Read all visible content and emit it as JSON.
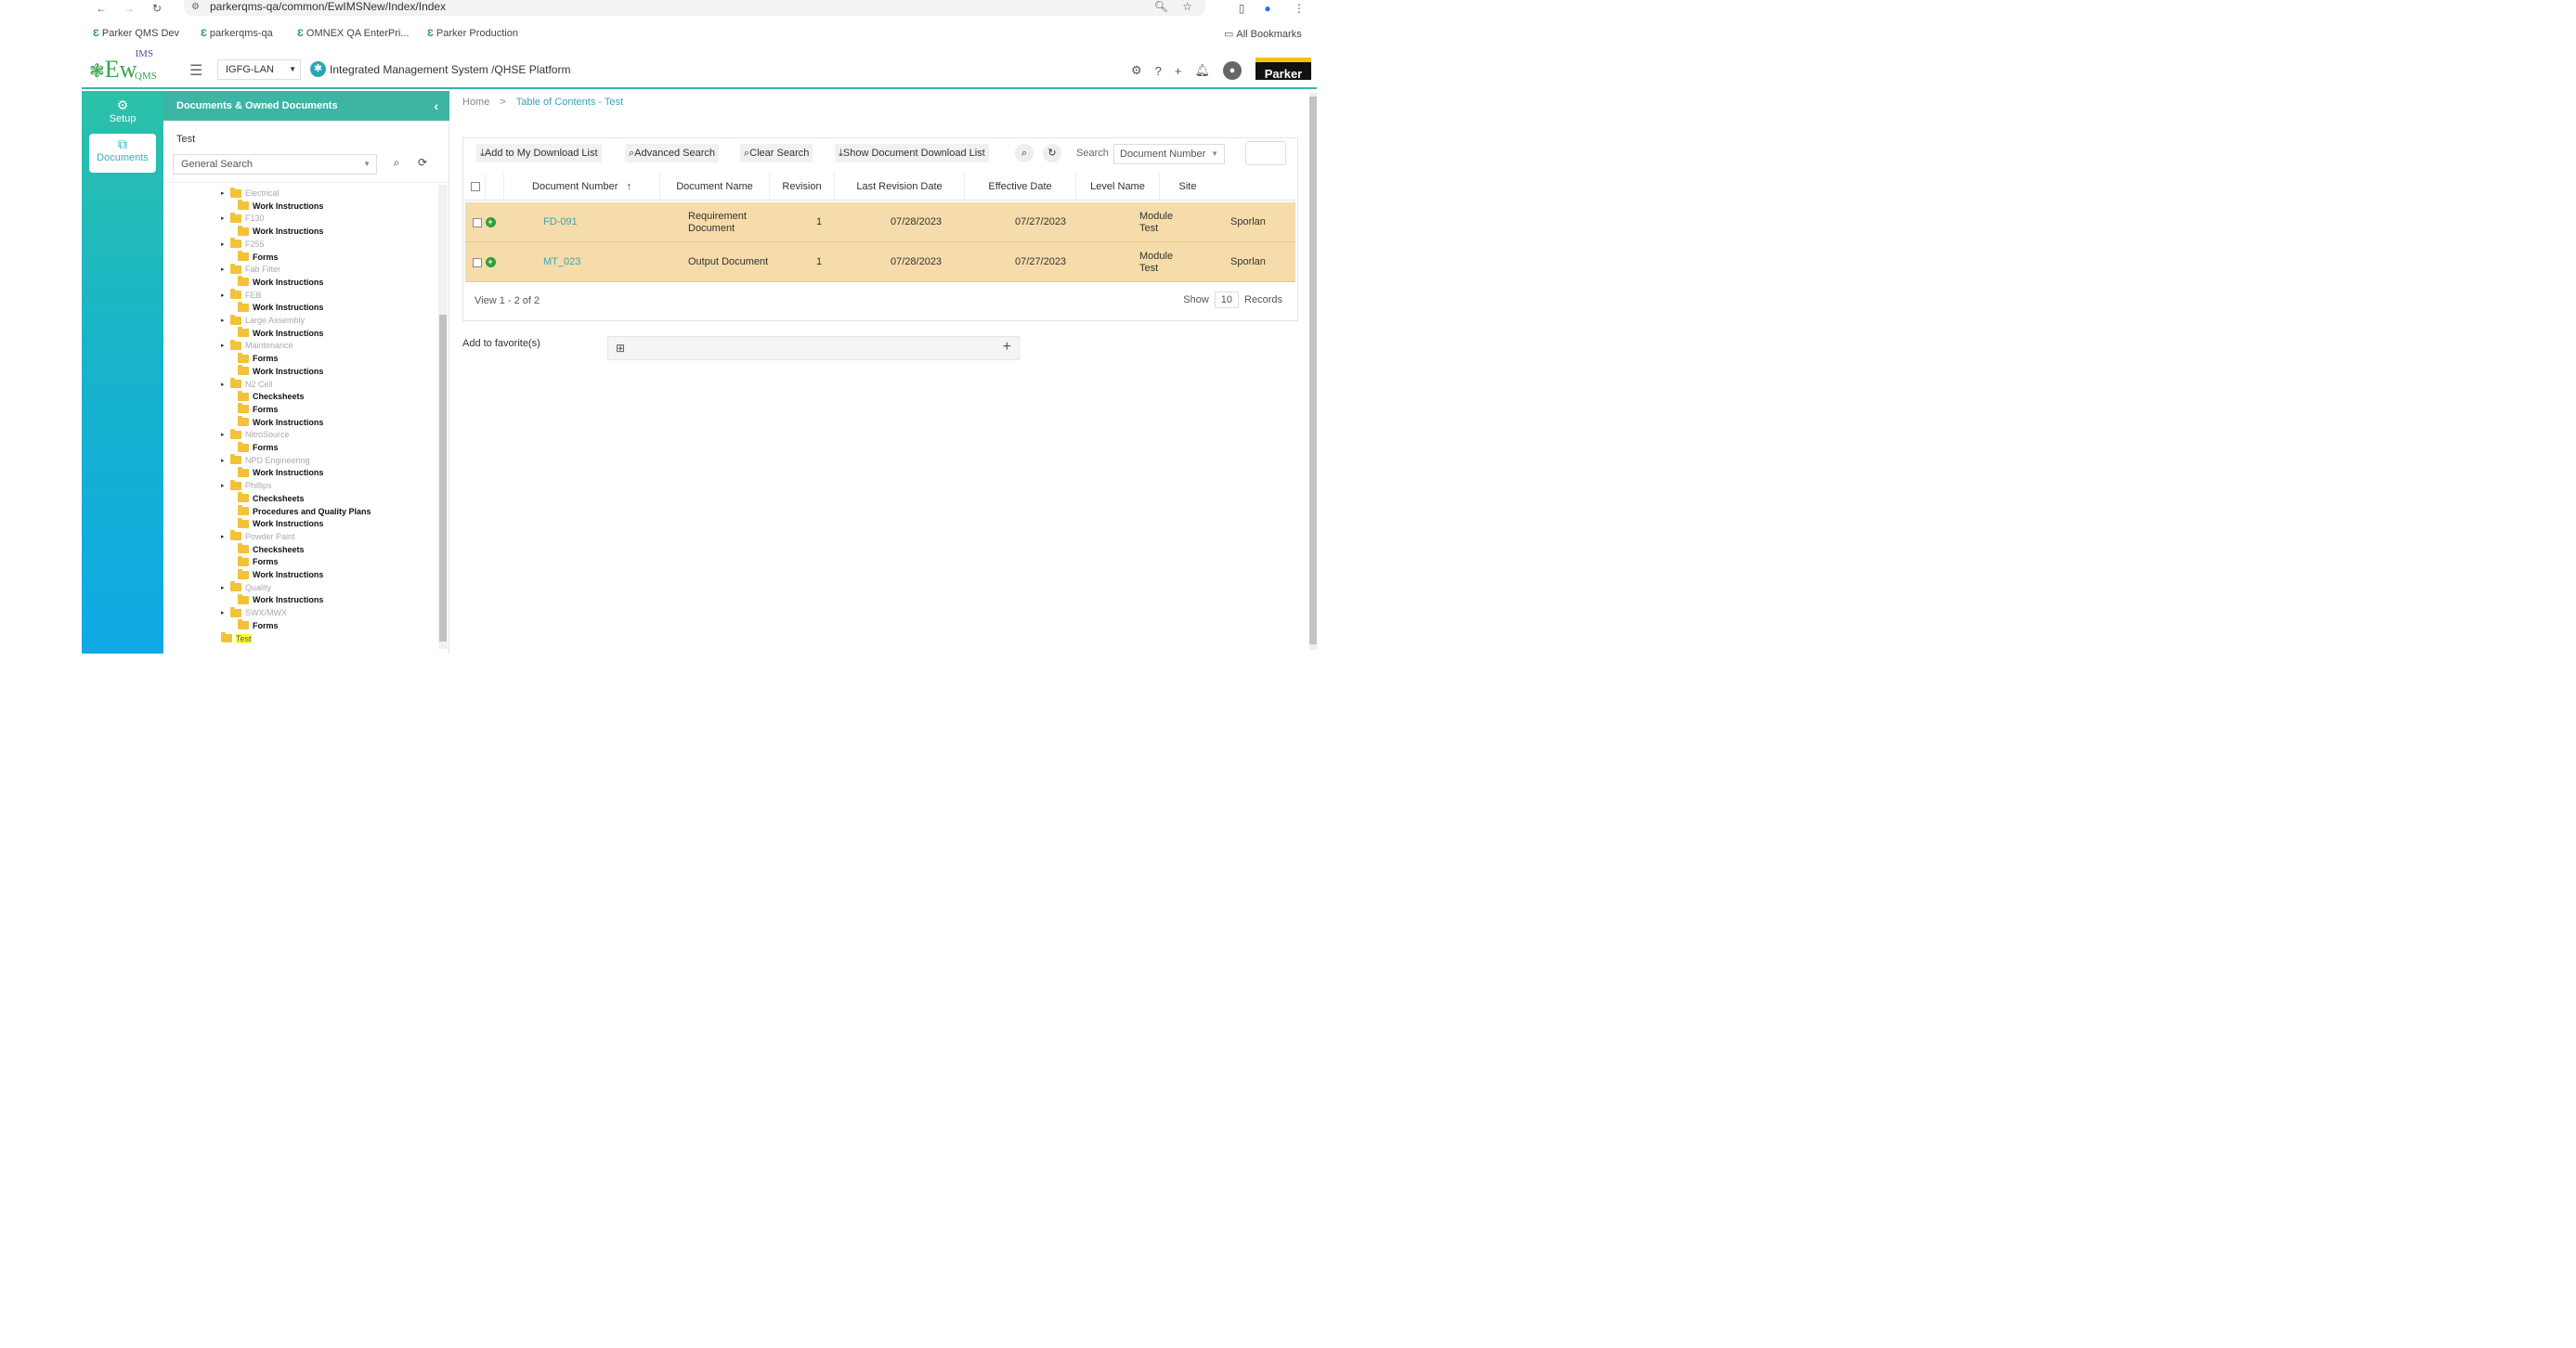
{
  "browser": {
    "url": "parkerqms-qa/common/EwIMSNew/Index/Index",
    "bookmarks": [
      "Parker QMS Dev",
      "parkerqms-qa",
      "OMNEX QA EnterPri...",
      "Parker Production"
    ],
    "all_bookmarks": "All Bookmarks"
  },
  "header": {
    "logo_text": "Ew",
    "logo_sup": "IMS",
    "logo_sub": "QMS",
    "org": "IGFG-LAN",
    "platform": "Integrated Management System /QHSE Platform",
    "brand": "Parker"
  },
  "rail": {
    "setup": "Setup",
    "documents": "Documents"
  },
  "tree_panel": {
    "title": "Documents & Owned Documents",
    "current": "Test",
    "search_placeholder": "General Search",
    "nodes": [
      {
        "label": "Electrical",
        "level": "parent"
      },
      {
        "label": "Work Instructions",
        "level": "child"
      },
      {
        "label": "F130",
        "level": "parent"
      },
      {
        "label": "Work Instructions",
        "level": "child"
      },
      {
        "label": "F255",
        "level": "parent"
      },
      {
        "label": "Forms",
        "level": "child"
      },
      {
        "label": "Fab Filter",
        "level": "parent"
      },
      {
        "label": "Work Instructions",
        "level": "child"
      },
      {
        "label": "FEB",
        "level": "parent"
      },
      {
        "label": "Work Instructions",
        "level": "child"
      },
      {
        "label": "Large Assembly",
        "level": "parent"
      },
      {
        "label": "Work Instructions",
        "level": "child"
      },
      {
        "label": "Maintenance",
        "level": "parent"
      },
      {
        "label": "Forms",
        "level": "child"
      },
      {
        "label": "Work Instructions",
        "level": "child"
      },
      {
        "label": "N2 Cell",
        "level": "parent"
      },
      {
        "label": "Checksheets",
        "level": "child"
      },
      {
        "label": "Forms",
        "level": "child"
      },
      {
        "label": "Work Instructions",
        "level": "child"
      },
      {
        "label": "NitroSource",
        "level": "parent"
      },
      {
        "label": "Forms",
        "level": "child"
      },
      {
        "label": "NPD Engineering",
        "level": "parent"
      },
      {
        "label": "Work Instructions",
        "level": "child"
      },
      {
        "label": "Phillips",
        "level": "parent"
      },
      {
        "label": "Checksheets",
        "level": "child"
      },
      {
        "label": "Procedures and Quality Plans",
        "level": "child"
      },
      {
        "label": "Work Instructions",
        "level": "child"
      },
      {
        "label": "Powder Paint",
        "level": "parent"
      },
      {
        "label": "Checksheets",
        "level": "child"
      },
      {
        "label": "Forms",
        "level": "child"
      },
      {
        "label": "Work Instructions",
        "level": "child"
      },
      {
        "label": "Quality",
        "level": "parent"
      },
      {
        "label": "Work Instructions",
        "level": "child"
      },
      {
        "label": "SWX/MWX",
        "level": "parent"
      },
      {
        "label": "Forms",
        "level": "child"
      },
      {
        "label": "Test",
        "level": "selected"
      }
    ]
  },
  "breadcrumb": {
    "home": "Home",
    "sep": ">",
    "current": "Table of Contents - Test"
  },
  "toolbar": {
    "add_download": "Add to My Download List",
    "advanced": "Advanced Search",
    "clear": "Clear Search",
    "show_download": "Show Document Download List",
    "search_label": "Search",
    "search_field": "Document Number"
  },
  "table": {
    "columns": [
      "Document Number",
      "Document Name",
      "Revision",
      "Last Revision Date",
      "Effective Date",
      "Level Name",
      "Site"
    ],
    "sort_indicator": "↑",
    "rows": [
      {
        "number": "FD-091",
        "name": "Requirement Document",
        "revision": "1",
        "last_rev": "07/28/2023",
        "effective": "07/27/2023",
        "level": "Module Test",
        "site": "Sporlan"
      },
      {
        "number": "MT_023",
        "name": "Output Document",
        "revision": "1",
        "last_rev": "07/28/2023",
        "effective": "07/27/2023",
        "level": "Module Test",
        "site": "Sporlan"
      }
    ],
    "pager": "View 1 - 2 of 2",
    "show": "Show",
    "page_size": "10",
    "records": "Records"
  },
  "favorites": {
    "label": "Add to favorite(s)"
  }
}
